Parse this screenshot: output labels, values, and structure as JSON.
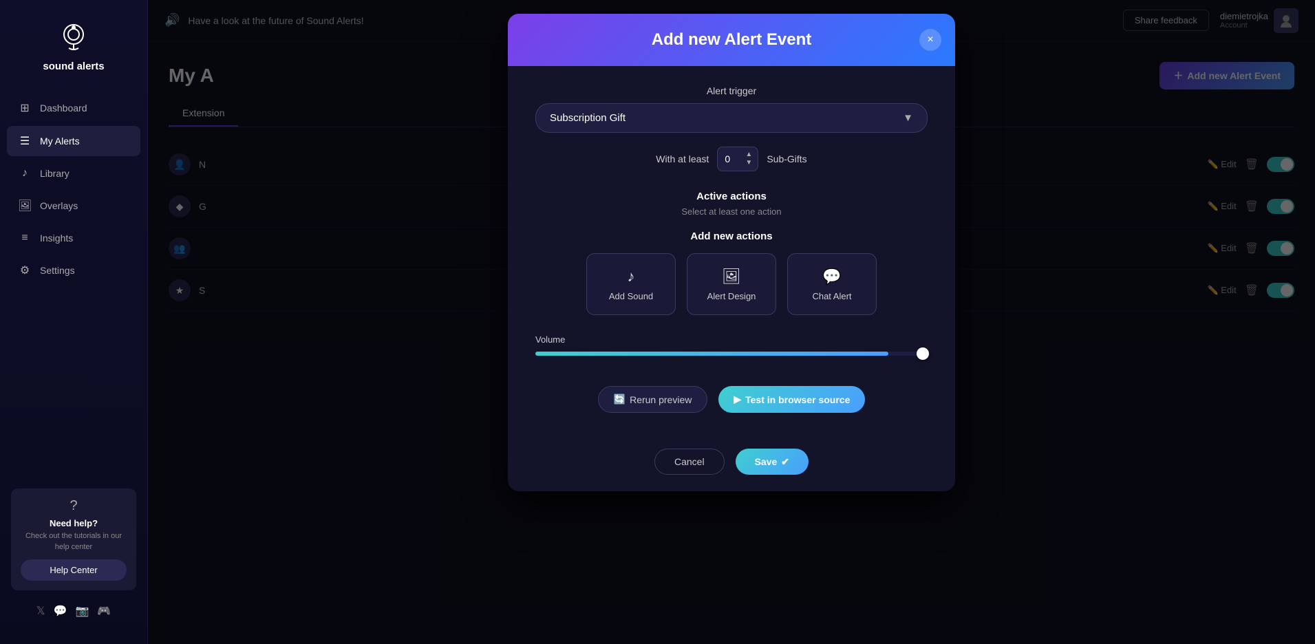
{
  "app": {
    "name": "sound alerts",
    "logo_emoji": "🎙️"
  },
  "sidebar": {
    "items": [
      {
        "id": "dashboard",
        "label": "Dashboard",
        "icon": "⊞",
        "active": false
      },
      {
        "id": "my-alerts",
        "label": "My Alerts",
        "icon": "☰",
        "active": true
      },
      {
        "id": "library",
        "label": "Library",
        "icon": "♪",
        "active": false
      },
      {
        "id": "overlays",
        "label": "Overlays",
        "icon": "🖼",
        "active": false
      },
      {
        "id": "insights",
        "label": "Insights",
        "icon": "≡",
        "active": false
      },
      {
        "id": "settings",
        "label": "Settings",
        "icon": "⚙",
        "active": false
      }
    ],
    "help": {
      "icon": "?",
      "title": "Need help?",
      "subtitle": "Check out the tutorials in our help center",
      "button_label": "Help Center"
    },
    "social": [
      "𝕏",
      "💬",
      "📷",
      "🎮"
    ]
  },
  "topbar": {
    "message": "Have a look at the future of Sound Alerts!",
    "speaker_icon": "🔊",
    "share_feedback_label": "Share feedback",
    "user": {
      "name": "diemietrojka",
      "sub_label": "Account"
    }
  },
  "page": {
    "title": "My A",
    "tabs": [
      {
        "label": "Extension",
        "active": true
      }
    ],
    "add_alert_label": "Add new Alert Event",
    "alert_rows": [
      {
        "icon": "👤",
        "name": "N",
        "id": "row1",
        "enabled": true
      },
      {
        "icon": "◆",
        "name": "G",
        "id": "row2",
        "enabled": true
      },
      {
        "icon": "👥",
        "name": "",
        "id": "row3",
        "enabled": true
      },
      {
        "icon": "★",
        "name": "S",
        "id": "row4",
        "enabled": true
      }
    ]
  },
  "modal": {
    "title": "Add new Alert Event",
    "close_label": "×",
    "alert_trigger_label": "Alert trigger",
    "alert_trigger_value": "Subscription Gift",
    "with_at_least_label": "With at least",
    "sub_gifts_label": "Sub-Gifts",
    "sub_gifts_value": "0",
    "active_actions_label": "Active actions",
    "select_action_hint": "Select at least one action",
    "add_new_actions_label": "Add new actions",
    "action_cards": [
      {
        "id": "add-sound",
        "label": "Add Sound",
        "icon": "♪"
      },
      {
        "id": "alert-design",
        "label": "Alert Design",
        "icon": "🖼"
      },
      {
        "id": "chat-alert",
        "label": "Chat Alert",
        "icon": "💬"
      }
    ],
    "volume_label": "Volume",
    "volume_value": 90,
    "rerun_preview_label": "Rerun preview",
    "test_browser_label": "Test in browser source",
    "cancel_label": "Cancel",
    "save_label": "Save"
  }
}
